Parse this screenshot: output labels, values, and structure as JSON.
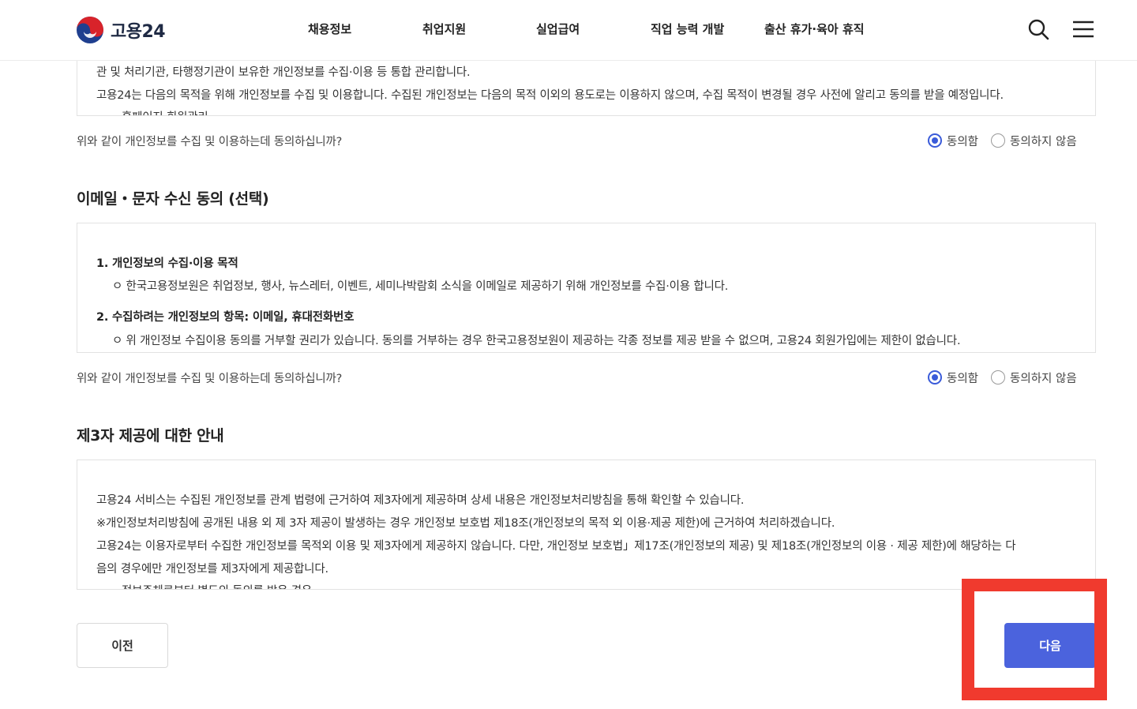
{
  "header": {
    "logo_text": "고용24",
    "nav": [
      "채용정보",
      "취업지원",
      "실업급여",
      "직업 능력 개발",
      "출산 휴가·육아 휴직"
    ]
  },
  "box1": {
    "lines": [
      "관 및 처리기관, 타행정기관이 보유한 개인정보를 수집·이용 등 통합 관리합니다.",
      "고용24는 다음의 목적을 위해 개인정보를 수집 및 이용합니다. 수집된 개인정보는 다음의 목적 이외의 용도로는 이용하지 않으며, 수집 목적이 변경될 경우 사전에 알리고 동의를 받을 예정입니다.",
      "홈페이지 회원관리"
    ]
  },
  "consent_question": "위와 같이 개인정보를 수집 및 이용하는데 동의하십니까?",
  "radio": {
    "agree": "동의함",
    "disagree": "동의하지 않음"
  },
  "section2": {
    "title": "이메일・문자 수신 동의 (선택)",
    "item1_title": "1. 개인정보의 수집·이용 목적",
    "item1_body": "ㅇ 한국고용정보원은 취업정보, 행사, 뉴스레터, 이벤트, 세미나박람회 소식을 이메일로 제공하기 위해 개인정보를 수집·이용 합니다.",
    "item2_title": "2. 수집하려는 개인정보의 항목: 이메일, 휴대전화번호",
    "item2_body": "ㅇ 위 개인정보 수집이용 동의를 거부할 권리가 있습니다. 동의를 거부하는 경우 한국고용정보원이 제공하는 각종 정보를 제공 받을 수 없으며, 고용24 회원가입에는 제한이 없습니다."
  },
  "section3": {
    "title": "제3자 제공에 대한 안내",
    "lines": [
      "고용24 서비스는 수집된 개인정보를 관계 법령에 근거하여 제3자에게 제공하며 상세 내용은 개인정보처리방침을 통해 확인할 수 있습니다.",
      "※개인정보처리방침에 공개된 내용 외 제 3자 제공이 발생하는 경우 개인정보 보호법 제18조(개인정보의 목적 외 이용·제공 제한)에 근거하여 처리하겠습니다.",
      "고용24는 이용자로부터 수집한 개인정보를 목적외 이용 및 제3자에게 제공하지 않습니다. 다만, 개인정보 보호법」제17조(개인정보의 제공) 및 제18조(개인정보의 이용 · 제공 제한)에 해당하는 다",
      "음의 경우에만 개인정보를 제3자에게 제공합니다.",
      "정보주체로부터 별도의 동의를 받은 경우"
    ]
  },
  "buttons": {
    "prev": "이전",
    "next": "다음"
  },
  "colors": {
    "primary": "#4b63dd",
    "highlight": "#f03a2e",
    "radio": "#3a5bd9"
  }
}
